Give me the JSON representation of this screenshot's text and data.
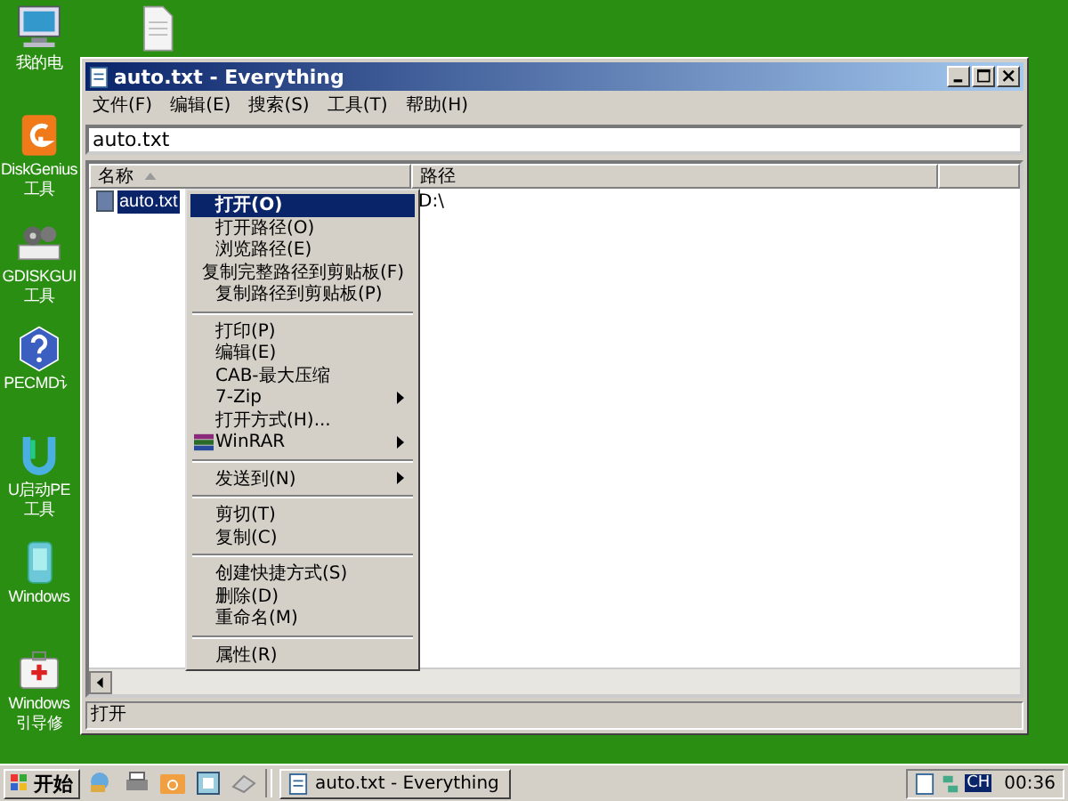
{
  "desktop_icons": [
    {
      "kind": "computer",
      "label": "我的电"
    },
    {
      "kind": "document"
    },
    {
      "kind": "disk",
      "label": "DiskGenius 工具"
    },
    {
      "kind": "gears",
      "label": "GDISKGUI 工具"
    },
    {
      "kind": "help",
      "label": "PECMD讠"
    },
    {
      "kind": "usb",
      "label": "U启动PE 工具"
    },
    {
      "kind": "phone",
      "label": "Windows"
    },
    {
      "kind": "firstaid",
      "label": "Windows 引导修"
    }
  ],
  "window": {
    "title": "auto.txt - Everything",
    "menu": [
      "文件(F)",
      "编辑(E)",
      "搜索(S)",
      "工具(T)",
      "帮助(H)"
    ],
    "search": {
      "value": "auto.txt"
    },
    "columns": [
      "名称",
      "路径"
    ],
    "rows": [
      {
        "name": "auto.txt",
        "path": "D:\\",
        "selected": true
      }
    ],
    "status_bar": "打开"
  },
  "context_menu": [
    [
      {
        "label": "打开(O)",
        "selected": true,
        "submenu": false
      },
      {
        "label": "打开路径(O)",
        "selected": false,
        "submenu": false
      },
      {
        "label": "浏览路径(E)",
        "selected": false,
        "submenu": false
      },
      {
        "label": "复制完整路径到剪贴板(F)",
        "selected": false,
        "submenu": false
      },
      {
        "label": "复制路径到剪贴板(P)",
        "selected": false,
        "submenu": false
      }
    ],
    [
      {
        "label": "打印(P)",
        "selected": false,
        "submenu": false
      },
      {
        "label": "编辑(E)",
        "selected": false,
        "submenu": false
      },
      {
        "label": "CAB-最大压缩",
        "selected": false,
        "submenu": false
      },
      {
        "label": "7-Zip",
        "selected": false,
        "submenu": true
      },
      {
        "label": "打开方式(H)...",
        "selected": false,
        "submenu": false
      },
      {
        "label": "WinRAR",
        "selected": false,
        "submenu": true,
        "kind": "with-icon"
      }
    ],
    [
      {
        "label": "发送到(N)",
        "selected": false,
        "submenu": true
      }
    ],
    [
      {
        "label": "剪切(T)",
        "selected": false,
        "submenu": false
      },
      {
        "label": "复制(C)",
        "selected": false,
        "submenu": false
      }
    ],
    [
      {
        "label": "创建快捷方式(S)",
        "selected": false,
        "submenu": false
      },
      {
        "label": "删除(D)",
        "selected": false,
        "submenu": false
      },
      {
        "label": "重命名(M)",
        "selected": false,
        "submenu": false
      }
    ],
    [
      {
        "label": "属性(R)",
        "selected": false,
        "submenu": false
      }
    ]
  ],
  "taskbar": {
    "start": "开始",
    "tasks": [
      {
        "title": "auto.txt - Everything",
        "selected": false
      }
    ],
    "clock": "00:36",
    "ime": "CH"
  }
}
